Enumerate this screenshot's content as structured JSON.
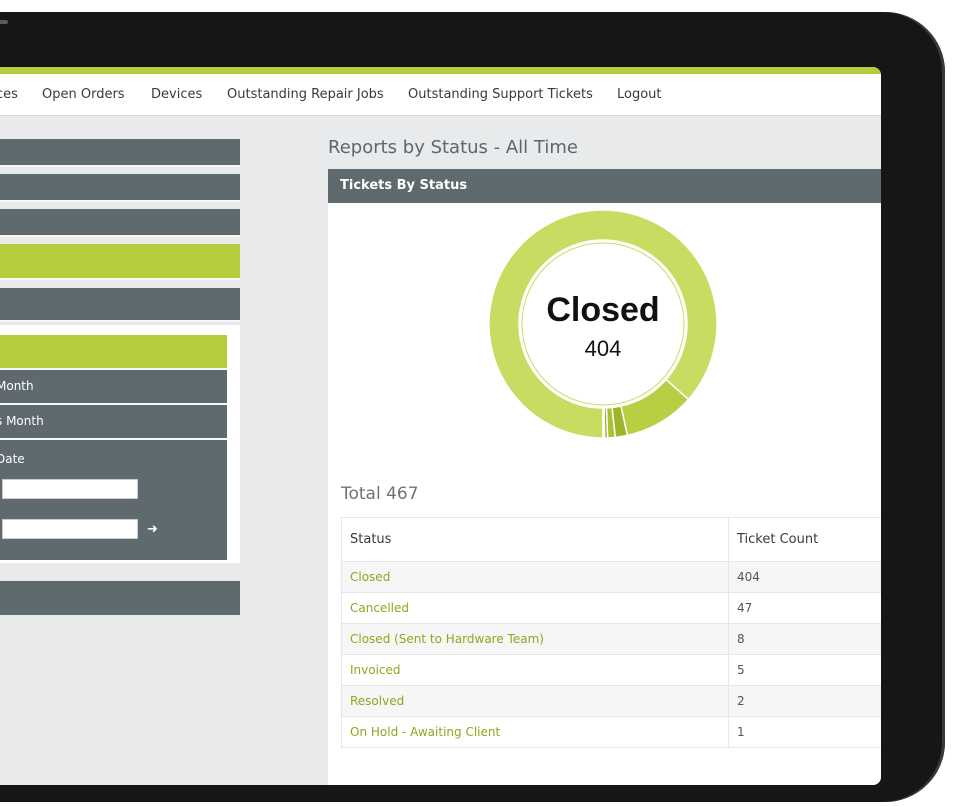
{
  "nav": {
    "items": [
      {
        "label": "ces"
      },
      {
        "label": "Open Orders"
      },
      {
        "label": "Devices"
      },
      {
        "label": "Outstanding Repair Jobs"
      },
      {
        "label": "Outstanding Support Tickets"
      },
      {
        "label": "Logout"
      }
    ]
  },
  "sidebar": {
    "date_items": [
      {
        "label": " Month"
      },
      {
        "label": "s Month"
      }
    ],
    "date_label": " Date",
    "go_icon": "arrow-right-icon"
  },
  "main": {
    "title": "Reports by Status - All Time",
    "card_header": "Tickets By Status",
    "donut": {
      "center_label": "Closed",
      "center_value": "404"
    },
    "total_label": "Total 467"
  },
  "table": {
    "headers": [
      "Status",
      "Ticket Count"
    ],
    "rows": [
      {
        "status": "Closed",
        "count": "404"
      },
      {
        "status": "Cancelled",
        "count": "47"
      },
      {
        "status": "Closed (Sent to Hardware Team)",
        "count": "8"
      },
      {
        "status": "Invoiced",
        "count": "5"
      },
      {
        "status": "Resolved",
        "count": "2"
      },
      {
        "status": "On Hold - Awaiting Client",
        "count": "1"
      }
    ]
  },
  "chart_data": {
    "type": "pie",
    "categories": [
      "Closed",
      "Cancelled",
      "Closed (Sent to Hardware Team)",
      "Invoiced",
      "Resolved",
      "On Hold - Awaiting Client"
    ],
    "values": [
      404,
      47,
      8,
      5,
      2,
      1
    ],
    "colors": [
      "#c9db60",
      "#b7cf42",
      "#9db52b",
      "#a9c232",
      "#8ea81e",
      "#7f9619"
    ]
  },
  "colors": {
    "accent": "#b5cd3a",
    "panel": "#5f6a6e",
    "link": "#8ea81e"
  }
}
